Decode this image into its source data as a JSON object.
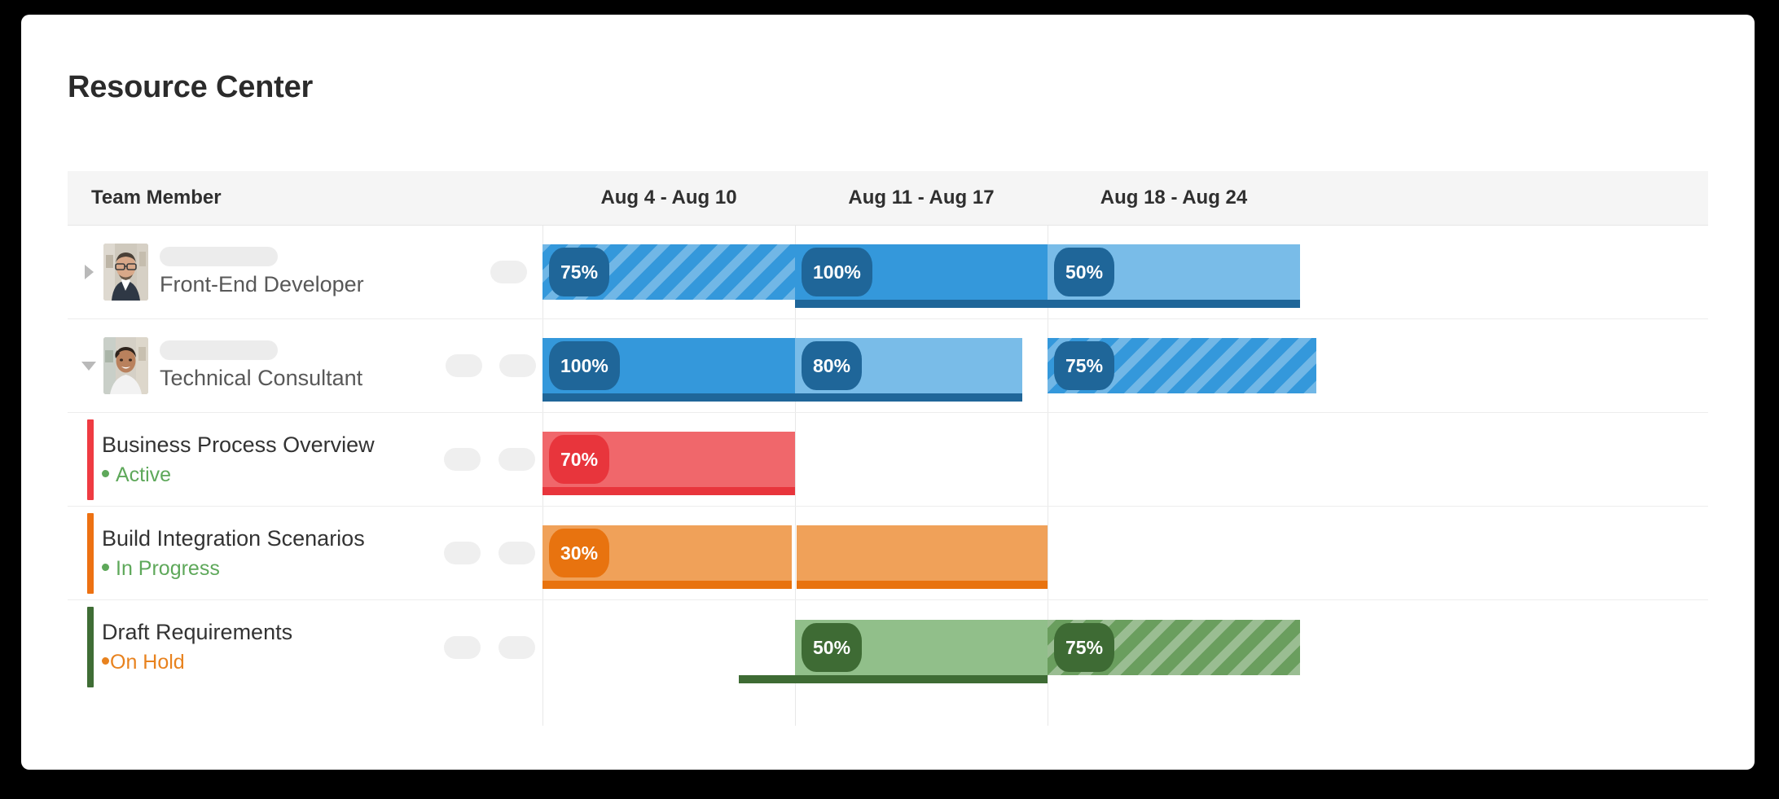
{
  "page": {
    "title": "Resource Center"
  },
  "table": {
    "columns": {
      "member": "Team Member",
      "weeks": [
        "Aug 4 - Aug 10",
        "Aug 11 - Aug 17",
        "Aug 18 - Aug 24"
      ]
    }
  },
  "colors": {
    "blue_solid": "#3498db",
    "blue_light": "#79bce8",
    "blue_dark": "#1f6699",
    "blue_stripe": "#6fb6e8",
    "red_bar": "#f0676b",
    "red_dark": "#e8353c",
    "red_accent": "#ef3b42",
    "orange_bar": "#f0a159",
    "orange_dark": "#e8730f",
    "orange_accent": "#ed7112",
    "green_bar": "#91bf8a",
    "green_dark": "#3e6b34",
    "green_accent": "#3f6d35",
    "status_active": "#5ea85a",
    "status_inprogress": "#5ea85a",
    "status_onhold": "#e8821e",
    "skeleton": "#ececec",
    "header_bg": "#f5f5f5"
  },
  "rows": [
    {
      "type": "member",
      "role": "Front-End Developer",
      "expanded": false,
      "expander_icon": "chevron-right-icon",
      "avatar": "avatar-male-glasses",
      "name_skeleton": true,
      "pills": 1,
      "bars": [
        {
          "week": 0,
          "label": "75%",
          "style": "striped",
          "color": "blue",
          "progress": false
        },
        {
          "week": 1,
          "label": "100%",
          "style": "solid",
          "color": "blue",
          "progress": true,
          "progress_pct": 100
        },
        {
          "week": 2,
          "label": "50%",
          "style": "solid-light",
          "color": "blue",
          "progress": true,
          "progress_pct": 100
        }
      ]
    },
    {
      "type": "member",
      "role": "Technical Consultant",
      "expanded": true,
      "expander_icon": "chevron-down-icon",
      "avatar": "avatar-female-smiling",
      "name_skeleton": true,
      "pills": 2,
      "bars": [
        {
          "week": 0,
          "label": "100%",
          "style": "solid",
          "color": "blue",
          "progress": true,
          "progress_pct": 100
        },
        {
          "week": 1,
          "label": "80%",
          "style": "solid-light",
          "color": "blue",
          "progress": true,
          "progress_pct": 100
        },
        {
          "week": 2,
          "label": "75%",
          "style": "striped",
          "color": "blue",
          "progress": false
        }
      ]
    },
    {
      "type": "task",
      "name": "Business Process Overview",
      "status": "Active",
      "status_color": "#5ea85a",
      "accent": "#ef3b42",
      "pills": 2,
      "bars": [
        {
          "week": 0,
          "span": 1,
          "label": "70%",
          "style": "solid",
          "color": "red",
          "progress": true,
          "progress_pct": 100
        }
      ]
    },
    {
      "type": "task",
      "name": "Build Integration Scenarios",
      "status": "In Progress",
      "status_color": "#5ea85a",
      "accent": "#ed7112",
      "pills": 2,
      "bars": [
        {
          "week": 0,
          "span": 2,
          "label": "30%",
          "style": "solid",
          "color": "orange",
          "progress": true,
          "progress_pct": 100
        }
      ]
    },
    {
      "type": "task",
      "name": "Draft Requirements",
      "status": "On Hold",
      "status_color": "#e8821e",
      "status_tight": true,
      "accent": "#3f6d35",
      "pills": 2,
      "bars": [
        {
          "week": 1,
          "span": 1,
          "label": "50%",
          "style": "solid",
          "color": "green",
          "progress": true,
          "progress_pct": 100,
          "progress_overhang": true
        },
        {
          "week": 2,
          "span": 1,
          "label": "75%",
          "style": "striped",
          "color": "green",
          "progress": false
        }
      ]
    }
  ]
}
